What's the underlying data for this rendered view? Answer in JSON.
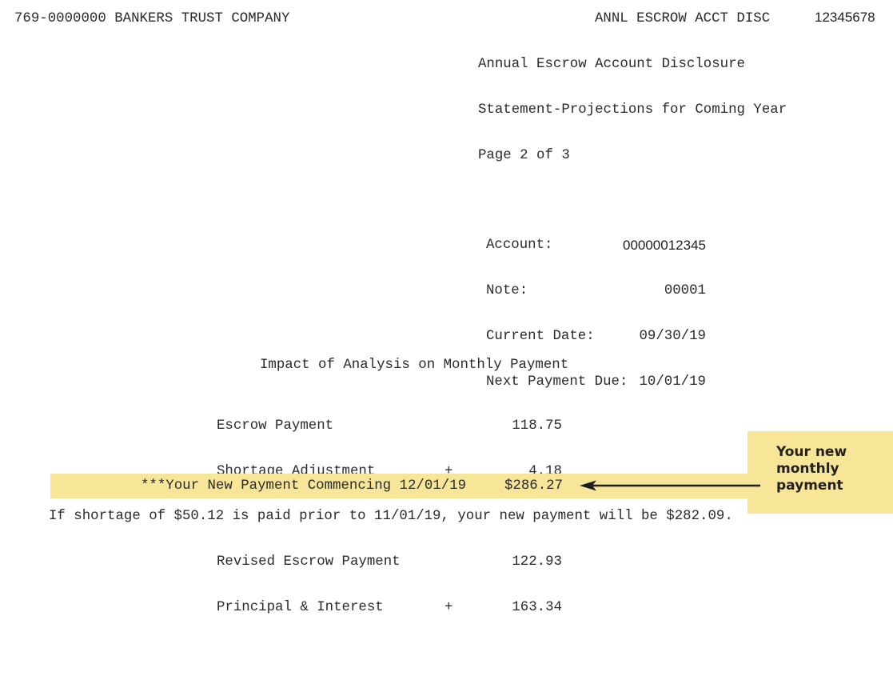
{
  "header": {
    "company_line": "769-0000000 BANKERS TRUST COMPANY",
    "form_code": "ANNL ESCROW ACCT DISC",
    "document_number": "12345678",
    "title_line_1": "Annual Escrow Account Disclosure",
    "title_line_2": "Statement-Projections for Coming Year",
    "page_indicator": "Page 2 of 3"
  },
  "account_info": [
    {
      "label": "Account:",
      "value": "00000012345"
    },
    {
      "label": "Note:",
      "value": "00001"
    },
    {
      "label": "Current Date:",
      "value": "09/30/19"
    },
    {
      "label": "Next Payment Due:",
      "value": "10/01/19"
    }
  ],
  "impact": {
    "title": "Impact of Analysis on Monthly Payment",
    "rows": [
      {
        "label": "Escrow Payment",
        "operator": "",
        "amount": "118.75"
      },
      {
        "label": "Shortage Adjustment",
        "operator": "+",
        "amount": "4.18"
      },
      {
        "label": "Revised Escrow Payment",
        "operator": "",
        "amount": "122.93"
      },
      {
        "label": "Principal & Interest",
        "operator": "+",
        "amount": "163.34"
      }
    ],
    "new_payment_label": "***Your New Payment Commencing 12/01/19",
    "new_payment_amount": "$286.27"
  },
  "shortage_note": "If shortage of $50.12 is paid prior to 11/01/19, your new payment will be $282.09.",
  "callout": {
    "text": "Your new\nmonthly\npayment",
    "arrow_icon": "arrow-left-icon"
  },
  "colors": {
    "highlight": "#f7e598",
    "text": "#2b2b2b"
  }
}
